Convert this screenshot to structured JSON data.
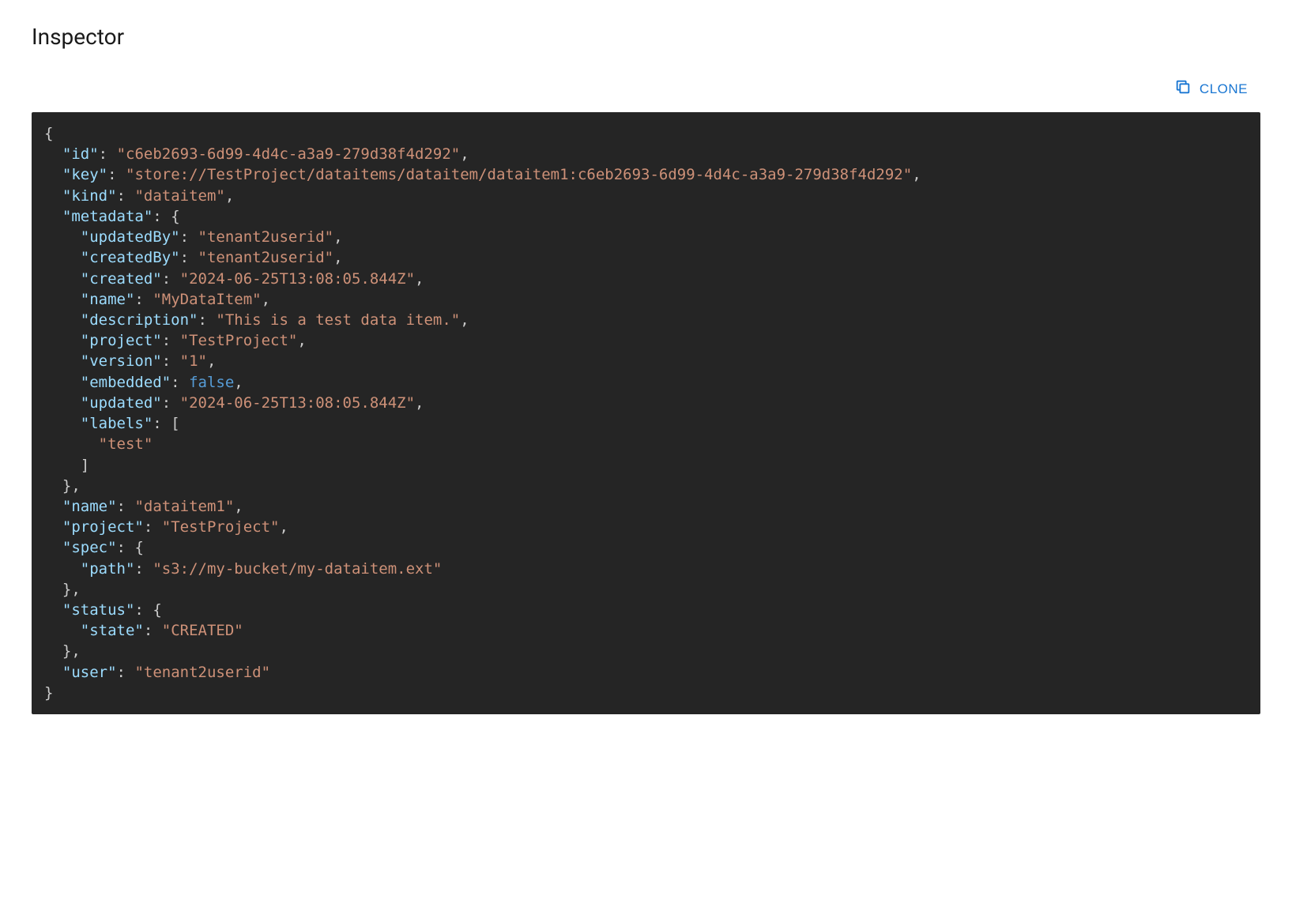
{
  "header": {
    "title": "Inspector"
  },
  "toolbar": {
    "clone_label": "CLONE"
  },
  "json_content": {
    "id": "c6eb2693-6d99-4d4c-a3a9-279d38f4d292",
    "key": "store://TestProject/dataitems/dataitem/dataitem1:c6eb2693-6d99-4d4c-a3a9-279d38f4d292",
    "kind": "dataitem",
    "metadata": {
      "updatedBy": "tenant2userid",
      "createdBy": "tenant2userid",
      "created": "2024-06-25T13:08:05.844Z",
      "name": "MyDataItem",
      "description": "This is a test data item.",
      "project": "TestProject",
      "version": "1",
      "embedded": false,
      "updated": "2024-06-25T13:08:05.844Z",
      "labels": [
        "test"
      ]
    },
    "name": "dataitem1",
    "project": "TestProject",
    "spec": {
      "path": "s3://my-bucket/my-dataitem.ext"
    },
    "status": {
      "state": "CREATED"
    },
    "user": "tenant2userid"
  }
}
